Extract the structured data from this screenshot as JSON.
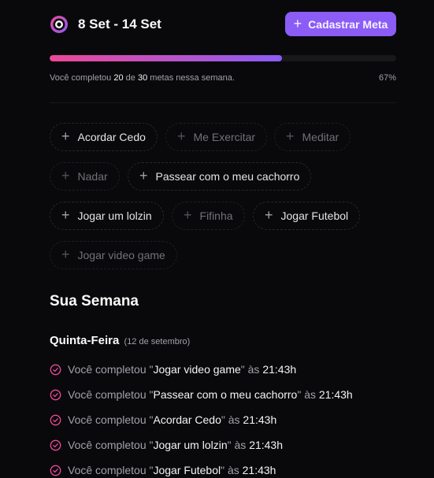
{
  "header": {
    "week_range": "8 Set - 14 Set",
    "add_button_label": "Cadastrar Meta"
  },
  "progress": {
    "text_prefix": "Você completou",
    "completed": "20",
    "text_middle": "de",
    "total": "30",
    "text_suffix": "metas nessa semana.",
    "percent_label": "67%",
    "fraction": 0.67
  },
  "goal_chips": [
    {
      "label": "Acordar Cedo",
      "done": false
    },
    {
      "label": "Me Exercitar",
      "done": true
    },
    {
      "label": "Meditar",
      "done": true
    },
    {
      "label": "Nadar",
      "done": true
    },
    {
      "label": "Passear com o meu cachorro",
      "done": false
    },
    {
      "label": "Jogar um lolzin",
      "done": false
    },
    {
      "label": "Fifinha",
      "done": true
    },
    {
      "label": "Jogar Futebol",
      "done": false
    },
    {
      "label": "Jogar video game",
      "done": true
    }
  ],
  "week_section": {
    "title": "Sua Semana",
    "day": {
      "name": "Quinta-Feira",
      "date": "(12 de setembro)",
      "entries": [
        {
          "prefix": "Você completou \"",
          "goal": "Jogar video game",
          "middle": "\" às ",
          "time": "21:43h"
        },
        {
          "prefix": "Você completou \"",
          "goal": "Passear com o meu cachorro",
          "middle": "\" às ",
          "time": "21:43h"
        },
        {
          "prefix": "Você completou \"",
          "goal": "Acordar Cedo",
          "middle": "\" às ",
          "time": "21:43h"
        },
        {
          "prefix": "Você completou \"",
          "goal": "Jogar um lolzin",
          "middle": "\" às ",
          "time": "21:43h"
        },
        {
          "prefix": "Você completou \"",
          "goal": "Jogar Futebol",
          "middle": "\" às ",
          "time": "21:43h"
        }
      ]
    }
  },
  "colors": {
    "background": "#09090b",
    "accent": "#8b5cf6",
    "gradient_start": "#ec4899",
    "check": "#ec4899"
  },
  "icons": {
    "logo": "target-ring-icon",
    "add": "plus-icon",
    "chip": "plus-icon",
    "entry": "check-circle-icon"
  }
}
